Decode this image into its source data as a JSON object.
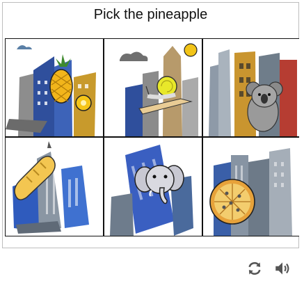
{
  "captcha": {
    "prompt": "Pick the pineapple",
    "tiles": [
      {
        "subject": "pineapple-icon",
        "background": "city-buildings"
      },
      {
        "subject": "snail-icon",
        "background": "city-buildings"
      },
      {
        "subject": "koala-icon",
        "background": "city-buildings"
      },
      {
        "subject": "bread-icon",
        "background": "city-buildings"
      },
      {
        "subject": "elephant-icon",
        "background": "city-buildings"
      },
      {
        "subject": "pizza-icon",
        "background": "city-buildings"
      }
    ]
  },
  "controls": {
    "refresh_icon": "refresh-icon",
    "audio_icon": "speaker-icon"
  },
  "colors": {
    "border": "#bdbdbd",
    "grid_line": "#111111",
    "icon": "#555555"
  }
}
